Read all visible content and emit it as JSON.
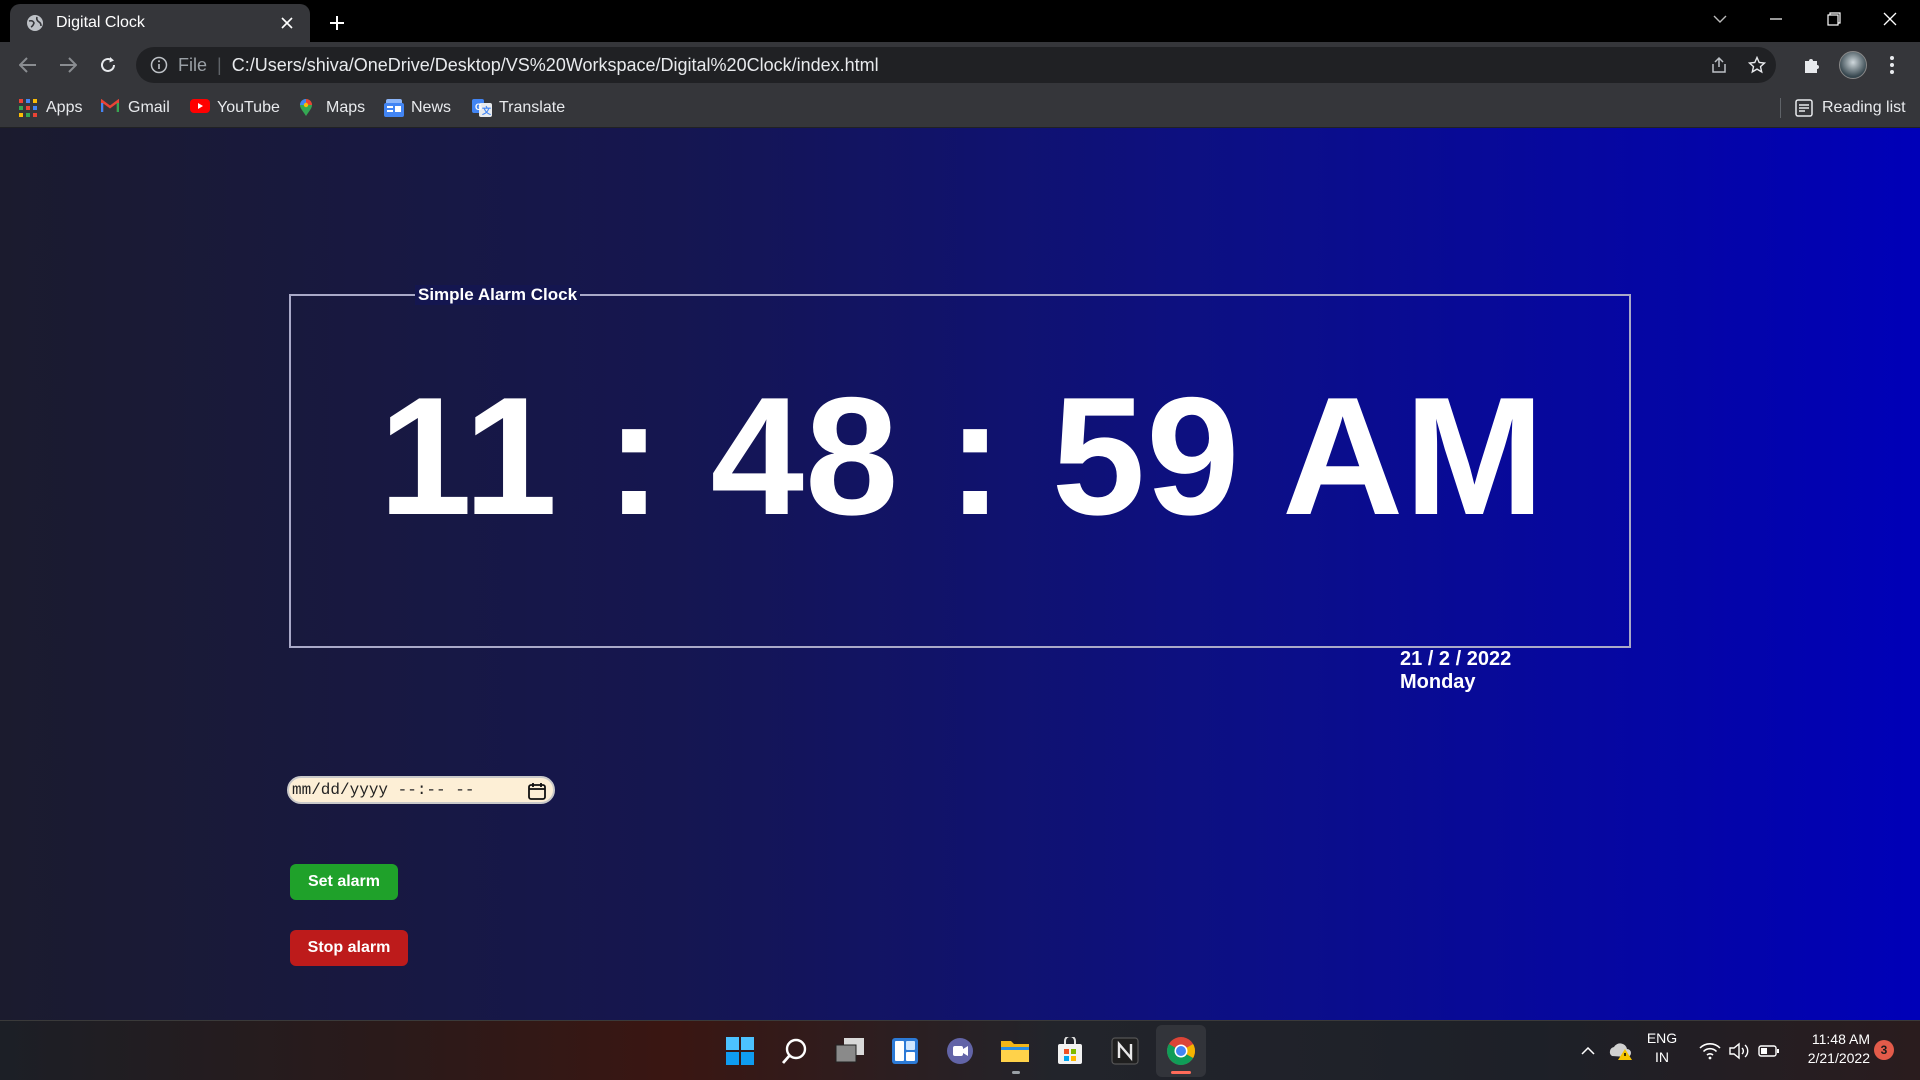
{
  "browser": {
    "tab_title": "Digital Clock",
    "address_scheme": "File",
    "address_url": "C:/Users/shiva/OneDrive/Desktop/VS%20Workspace/Digital%20Clock/index.html",
    "bookmarks": [
      {
        "label": "Apps",
        "icon": "apps-grid-icon"
      },
      {
        "label": "Gmail",
        "icon": "gmail-icon"
      },
      {
        "label": "YouTube",
        "icon": "youtube-icon"
      },
      {
        "label": "Maps",
        "icon": "maps-icon"
      },
      {
        "label": "News",
        "icon": "news-icon"
      },
      {
        "label": "Translate",
        "icon": "translate-icon"
      }
    ],
    "reading_list_label": "Reading list"
  },
  "page": {
    "legend": "Simple Alarm Clock",
    "clock_display": "11 : 48 : 59 AM",
    "date_display": "21 / 2 / 2022",
    "day_display": "Monday",
    "datetime_input_placeholder": "mm/dd/yyyy --:-- --",
    "set_alarm_label": "Set alarm",
    "stop_alarm_label": "Stop alarm",
    "colors": {
      "set_alarm": "#1fa12a",
      "stop_alarm": "#bd1b1b",
      "background_start": "#1b1b2e",
      "background_end": "#0000b8"
    }
  },
  "taskbar": {
    "apps": [
      "start-icon",
      "search-icon",
      "task-view-icon",
      "widgets-icon",
      "teams-chat-icon",
      "file-explorer-icon",
      "microsoft-store-icon",
      "notion-icon",
      "chrome-icon"
    ],
    "language_top": "ENG",
    "language_bottom": "IN",
    "time": "11:48 AM",
    "date": "2/21/2022",
    "notification_count": "3"
  }
}
